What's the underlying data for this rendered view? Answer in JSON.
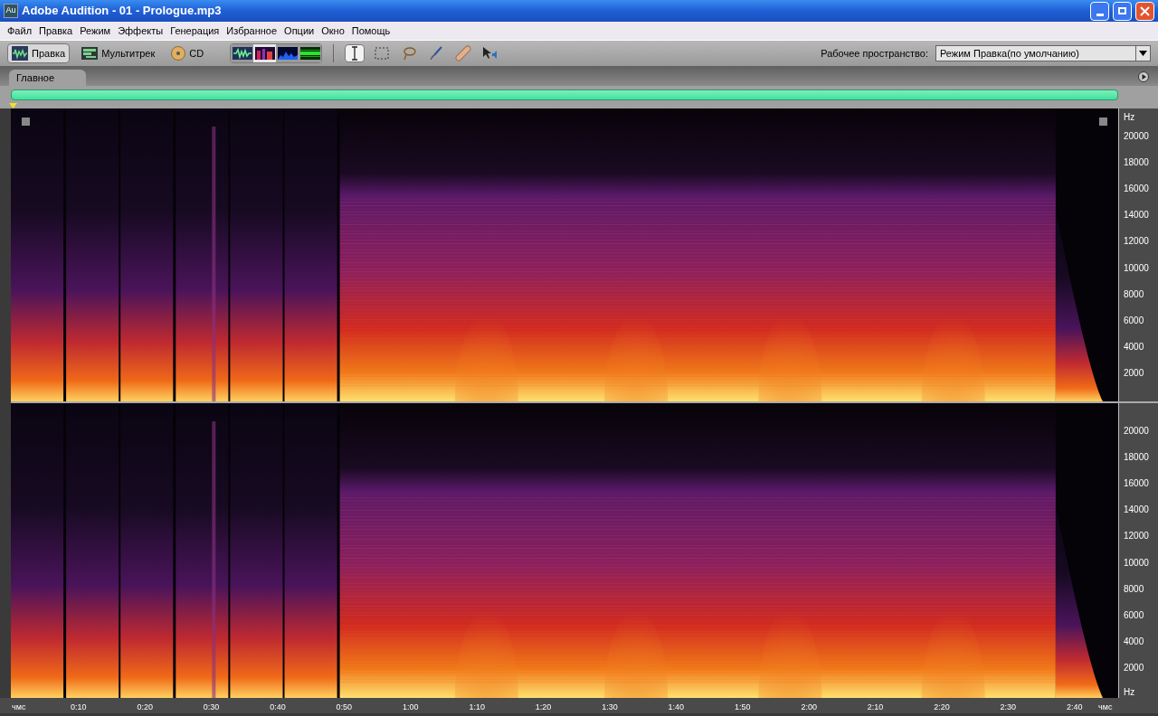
{
  "window": {
    "title": "Adobe Audition - 01 - Prologue.mp3",
    "app_badge": "Au"
  },
  "menu": [
    "Файл",
    "Правка",
    "Режим",
    "Эффекты",
    "Генерация",
    "Избранное",
    "Опции",
    "Окно",
    "Помощь"
  ],
  "modes": [
    {
      "label": "Правка",
      "kind": "edit",
      "selected": true
    },
    {
      "label": "Мультитрек",
      "kind": "multitrack",
      "selected": false
    },
    {
      "label": "CD",
      "kind": "cd",
      "selected": false
    }
  ],
  "views": [
    {
      "kind": "waveform",
      "selected": false
    },
    {
      "kind": "spectral",
      "selected": true
    },
    {
      "kind": "pan",
      "selected": false
    },
    {
      "kind": "phase",
      "selected": false
    }
  ],
  "tools": [
    {
      "kind": "ibeam",
      "selected": true
    },
    {
      "kind": "marquee",
      "selected": false
    },
    {
      "kind": "lasso",
      "selected": false
    },
    {
      "kind": "brush",
      "selected": false
    },
    {
      "kind": "heal",
      "selected": false
    },
    {
      "kind": "scrub",
      "selected": false
    }
  ],
  "workspace": {
    "label": "Рабочее пространство:",
    "value": "Режим Правка(по умолчанию)"
  },
  "panel": {
    "tab": "Главное"
  },
  "channels": [
    {
      "unit": "Hz",
      "ticks": [
        "20000",
        "18000",
        "16000",
        "14000",
        "12000",
        "10000",
        "8000",
        "6000",
        "4000",
        "2000"
      ]
    },
    {
      "unit": "Hz",
      "ticks": [
        "20000",
        "18000",
        "16000",
        "14000",
        "12000",
        "10000",
        "8000",
        "6000",
        "4000",
        "2000"
      ]
    }
  ],
  "time_ruler": {
    "start": "чмс",
    "end": "чмс",
    "ticks": [
      "0:10",
      "0:20",
      "0:30",
      "0:40",
      "0:50",
      "1:00",
      "1:10",
      "1:20",
      "1:30",
      "1:40",
      "1:50",
      "2:00",
      "2:10",
      "2:20",
      "2:30",
      "2:40"
    ]
  }
}
